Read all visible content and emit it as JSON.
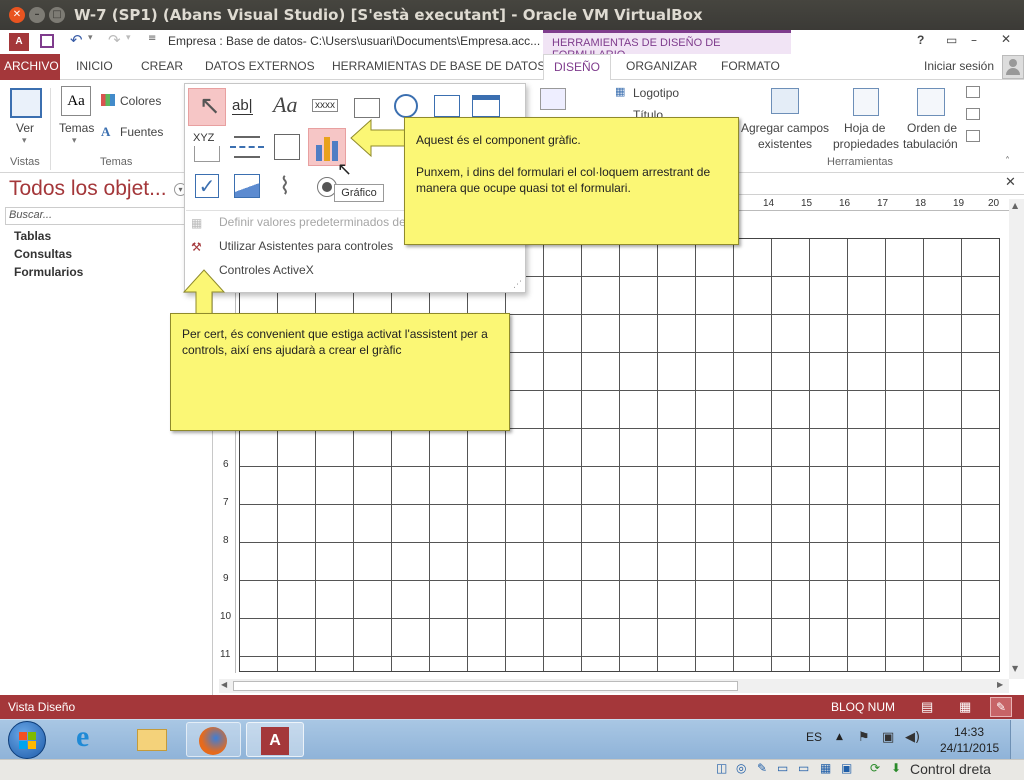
{
  "window": {
    "title": "W-7 (SP1) (Abans Visual Studio) [S'està executant] - Oracle VM VirtualBox"
  },
  "qat": {
    "doc_title": "Empresa : Base de datos- C:\\Users\\usuari\\Documents\\Empresa.acc...",
    "context_tab": "HERRAMIENTAS DE DISEÑO DE FORMULARIO",
    "help": "?"
  },
  "tabs": [
    "ARCHIVO",
    "INICIO",
    "CREAR",
    "DATOS EXTERNOS",
    "HERRAMIENTAS DE BASE DE DATOS",
    "DISEÑO",
    "ORGANIZAR",
    "FORMATO"
  ],
  "signin": "Iniciar sesión",
  "ribbon": {
    "ver": "Ver",
    "temas": "Temas",
    "colores": "Colores",
    "fuentes": "Fuentes",
    "vistas_label": "Vistas",
    "temas_label": "Temas",
    "logotipo": "Logotipo",
    "titulo": "Título",
    "agregar1": "Agregar campos",
    "agregar2": "existentes",
    "hoja1": "Hoja de",
    "hoja2": "propiedades",
    "orden1": "Orden de",
    "orden2": "tabulación",
    "herramientas_label": "Herramientas"
  },
  "nav": {
    "title": "Todos los objet...",
    "search_placeholder": "Buscar...",
    "items": [
      "Tablas",
      "Consultas",
      "Formularios"
    ]
  },
  "controls_menu": {
    "text_sample": "ab|",
    "aa": "Aa",
    "xxxx": "xxxx",
    "xyz": "XYZ",
    "tooltip": "Gráfico",
    "item1": "Definir valores predeterminados de",
    "item2": "Utilizar Asistentes para controles",
    "item3": "Controles ActiveX"
  },
  "ruler": {
    "numbers": [
      "14",
      "15",
      "16",
      "17",
      "18",
      "19",
      "20"
    ],
    "v_numbers": [
      "6",
      "7",
      "8",
      "9",
      "10",
      "11"
    ]
  },
  "note1": {
    "line1": "Aquest és el component gràfic.",
    "line2": "Punxem, i dins del formulari el col·loquem arrestrant de manera que ocupe quasi tot el formulari."
  },
  "note2": {
    "text": "Per cert, és convenient que estiga activat l'assistent per a controls, així ens ajudarà a crear el gràfic"
  },
  "status": {
    "left": "Vista Diseño",
    "bloq": "BLOQ NUM"
  },
  "taskbar": {
    "lang": "ES",
    "time": "14:33",
    "date": "24/11/2015"
  },
  "vbox": {
    "host_key": "Control dreta"
  },
  "colors": {
    "access_red": "#a4373a",
    "note_yellow": "#fbf775",
    "accent_purple": "#7f3c8d"
  }
}
